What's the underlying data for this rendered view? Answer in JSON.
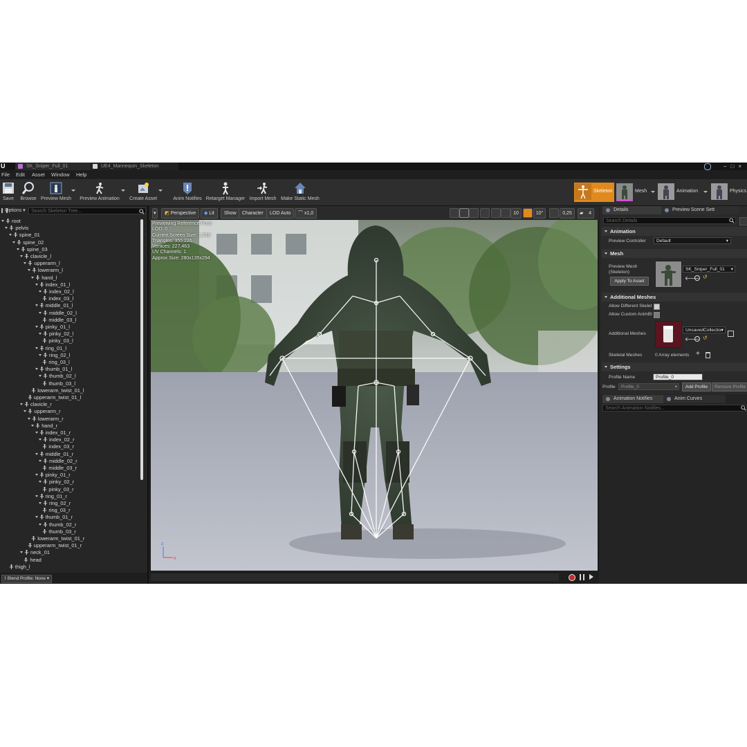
{
  "titlebar": {
    "tabs": [
      {
        "label": "SK_Sniper_Full_01",
        "color": "#b46fd0"
      },
      {
        "label": "UE4_Mannequin_Skeleton",
        "color": "#d7d7d7"
      }
    ]
  },
  "menu": {
    "items": [
      "File",
      "Edit",
      "Asset",
      "Window",
      "Help"
    ]
  },
  "toolbar": {
    "save": "Save",
    "browse": "Browse",
    "preview_mesh": "Preview Mesh",
    "preview_animation": "Preview Animation",
    "create_asset": "Create Asset",
    "anim_notifies": "Anim Notifies",
    "retarget_manager": "Retarget Manager",
    "import_mesh": "Import Mesh",
    "make_static_mesh": "Make Static Mesh"
  },
  "modes": {
    "skeleton": "Skeleton",
    "mesh": "Mesh",
    "animation": "Animation",
    "physics": "Physics",
    "active_color": "#e08a1e"
  },
  "skeleton_tree": {
    "options": "Options",
    "search_placeholder": "Search Skeleton Tree...",
    "bones": [
      {
        "name": "root",
        "depth": 0
      },
      {
        "name": "pelvis",
        "depth": 1
      },
      {
        "name": "spine_01",
        "depth": 2
      },
      {
        "name": "spine_02",
        "depth": 3
      },
      {
        "name": "spine_03",
        "depth": 4
      },
      {
        "name": "clavicle_l",
        "depth": 5
      },
      {
        "name": "upperarm_l",
        "depth": 6
      },
      {
        "name": "lowerarm_l",
        "depth": 7
      },
      {
        "name": "hand_l",
        "depth": 8
      },
      {
        "name": "index_01_l",
        "depth": 9
      },
      {
        "name": "index_02_l",
        "depth": 10
      },
      {
        "name": "index_03_l",
        "depth": 11
      },
      {
        "name": "middle_01_l",
        "depth": 9
      },
      {
        "name": "middle_02_l",
        "depth": 10
      },
      {
        "name": "middle_03_l",
        "depth": 11
      },
      {
        "name": "pinky_01_l",
        "depth": 9
      },
      {
        "name": "pinky_02_l",
        "depth": 10
      },
      {
        "name": "pinky_03_l",
        "depth": 11
      },
      {
        "name": "ring_01_l",
        "depth": 9
      },
      {
        "name": "ring_02_l",
        "depth": 10
      },
      {
        "name": "ring_03_l",
        "depth": 11
      },
      {
        "name": "thumb_01_l",
        "depth": 9
      },
      {
        "name": "thumb_02_l",
        "depth": 10
      },
      {
        "name": "thumb_03_l",
        "depth": 11
      },
      {
        "name": "lowerarm_twist_01_l",
        "depth": 8
      },
      {
        "name": "upperarm_twist_01_l",
        "depth": 7
      },
      {
        "name": "clavicle_r",
        "depth": 5
      },
      {
        "name": "upperarm_r",
        "depth": 6
      },
      {
        "name": "lowerarm_r",
        "depth": 7
      },
      {
        "name": "hand_r",
        "depth": 8
      },
      {
        "name": "index_01_r",
        "depth": 9
      },
      {
        "name": "index_02_r",
        "depth": 10
      },
      {
        "name": "index_03_r",
        "depth": 11
      },
      {
        "name": "middle_01_r",
        "depth": 9
      },
      {
        "name": "middle_02_r",
        "depth": 10
      },
      {
        "name": "middle_03_r",
        "depth": 11
      },
      {
        "name": "pinky_01_r",
        "depth": 9
      },
      {
        "name": "pinky_02_r",
        "depth": 10
      },
      {
        "name": "pinky_03_r",
        "depth": 11
      },
      {
        "name": "ring_01_r",
        "depth": 9
      },
      {
        "name": "ring_02_r",
        "depth": 10
      },
      {
        "name": "ring_03_r",
        "depth": 11
      },
      {
        "name": "thumb_01_r",
        "depth": 9
      },
      {
        "name": "thumb_02_r",
        "depth": 10
      },
      {
        "name": "thumb_03_r",
        "depth": 11
      },
      {
        "name": "lowerarm_twist_01_r",
        "depth": 8
      },
      {
        "name": "upperarm_twist_01_r",
        "depth": 7
      },
      {
        "name": "neck_01",
        "depth": 5
      },
      {
        "name": "head",
        "depth": 6
      },
      {
        "name": "thigh_l",
        "depth": 2
      }
    ],
    "blend_profile": "Blend Profile: None"
  },
  "viewport": {
    "perspective": "Perspective",
    "lit": "Lit",
    "show": "Show",
    "character": "Character",
    "lod": "LOD Auto",
    "speed": "x1,0",
    "grid_snap": "10",
    "rot_snap": "10°",
    "scale_snap": "0,25",
    "cam_speed": "4",
    "stats": [
      "Previewing Reference Pose",
      "LOD: 0",
      "Current Screen Size: 1,519",
      "Triangles: 355,226",
      "Vertices: 227,463",
      "UV Channels: 1",
      "Approx Size: 280x135x294"
    ]
  },
  "details": {
    "tab_details": "Details",
    "tab_preview": "Preview Scene Sett",
    "search_placeholder": "Search Details",
    "animation_section": "Animation",
    "preview_controller_label": "Preview Controller",
    "preview_controller_value": "Default",
    "mesh_section": "Mesh",
    "preview_mesh_label": "Preview Mesh (Skeleton)",
    "preview_mesh_value": "SK_Sniper_Full_01",
    "apply_to_asset": "Apply To Asset",
    "additional_meshes_section": "Additional Meshes",
    "allow_different_label": "Allow Different Skelet",
    "allow_custom_label": "Allow Custom AnimBl",
    "additional_meshes_label": "Additional Meshes",
    "additional_meshes_value": "UnsavedCollectior",
    "skeletal_meshes_label": "Skeletal Meshes",
    "skeletal_meshes_value": "0 Array elements",
    "settings_section": "Settings",
    "profile_name_label": "Profile Name",
    "profile_name_value": "Profile_0",
    "profile_label": "Profile",
    "profile_value": "Profile_0",
    "add_profile": "Add Profile",
    "remove_profile": "Remove Profile"
  },
  "anim_panel": {
    "tab_notifies": "Animation Notifies",
    "tab_curves": "Anim Curves",
    "search_placeholder": "Search Animation Notifies..."
  }
}
